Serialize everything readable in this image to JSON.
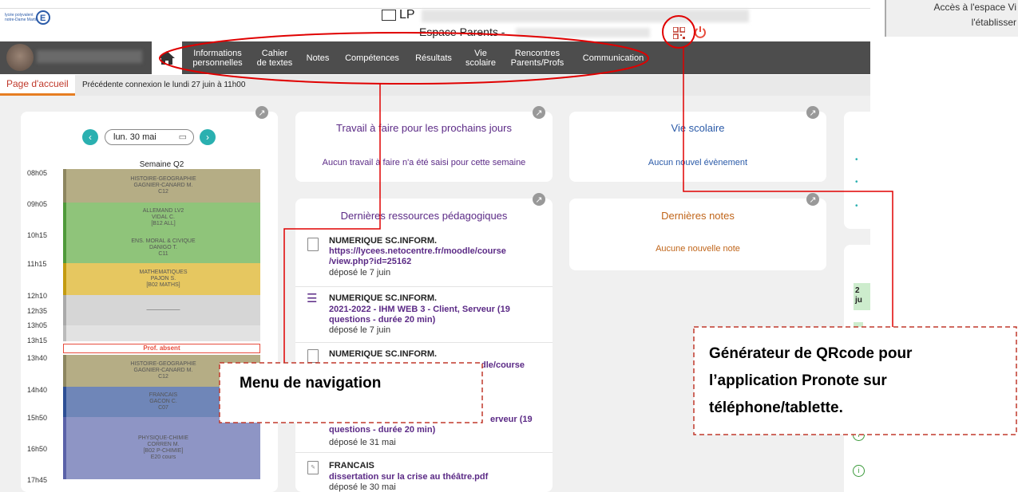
{
  "header": {
    "school_prefix": "LP",
    "espace_label": "Espace Parents -"
  },
  "nav": {
    "items": [
      {
        "label": "Informations\npersonnelles"
      },
      {
        "label": "Cahier\nde textes"
      },
      {
        "label": "Notes"
      },
      {
        "label": "Compétences"
      },
      {
        "label": "Résultats"
      },
      {
        "label": "Vie\nscolaire"
      },
      {
        "label": "Rencontres\nParents/Profs"
      },
      {
        "label": "Communication"
      }
    ]
  },
  "subbar": {
    "tab": "Page d'accueil",
    "previous_connection": "Précédente connexion le lundi 27 juin à 11h00"
  },
  "timetable": {
    "date": "lun. 30 mai",
    "week": "Semaine Q2",
    "times": [
      "08h05",
      "09h05",
      "10h15",
      "11h15",
      "12h10",
      "12h35",
      "13h05",
      "13h15",
      "13h40",
      "14h40",
      "15h50",
      "16h50",
      "17h45"
    ],
    "absent_label": "Prof. absent"
  },
  "homework": {
    "title": "Travail à faire pour les prochains jours",
    "empty": "Aucun travail à faire n'a été saisi pour cette semaine"
  },
  "vie_scolaire": {
    "title": "Vie scolaire",
    "empty": "Aucun nouvel évènement"
  },
  "resources": {
    "title": "Dernières ressources pédagogiques",
    "items": [
      {
        "subject": "NUMERIQUE SC.INFORM.",
        "link": "https://lycees.netocentre.fr/moodle/course\n/view.php?id=25162",
        "date": "déposé le 7 juin"
      },
      {
        "subject": "NUMERIQUE SC.INFORM.",
        "link": "2021-2022 - IHM WEB 3 - Client, Serveur (19\nquestions - durée 20 min)",
        "date": "déposé le 7 juin"
      },
      {
        "subject": "NUMERIQUE SC.INFORM.",
        "link": "dle/course",
        "date": ""
      },
      {
        "subject": "",
        "link": "erveur (19\nquestions - durée 20 min)",
        "date": "déposé le 31 mai"
      },
      {
        "subject": "FRANCAIS",
        "link": "dissertation sur la crise au théâtre.pdf",
        "date": "déposé le 30 mai"
      }
    ]
  },
  "notes": {
    "title": "Dernières notes",
    "empty": "Aucune nouvelle note"
  },
  "annotations": {
    "menu": "Menu de navigation",
    "qr": "Générateur de QRcode pour\nl’application Pronote sur\ntéléphone/tablette."
  },
  "right_panel": {
    "text": "Accès à l'espace Vi\nl'établisser",
    "badge": "2\nju"
  },
  "colors": {
    "accent_orange": "#e67e22",
    "nav_bg": "#4d4d4d",
    "purple": "#5b2a86",
    "teal": "#2ab0b0",
    "annotation_red": "#e00000"
  }
}
